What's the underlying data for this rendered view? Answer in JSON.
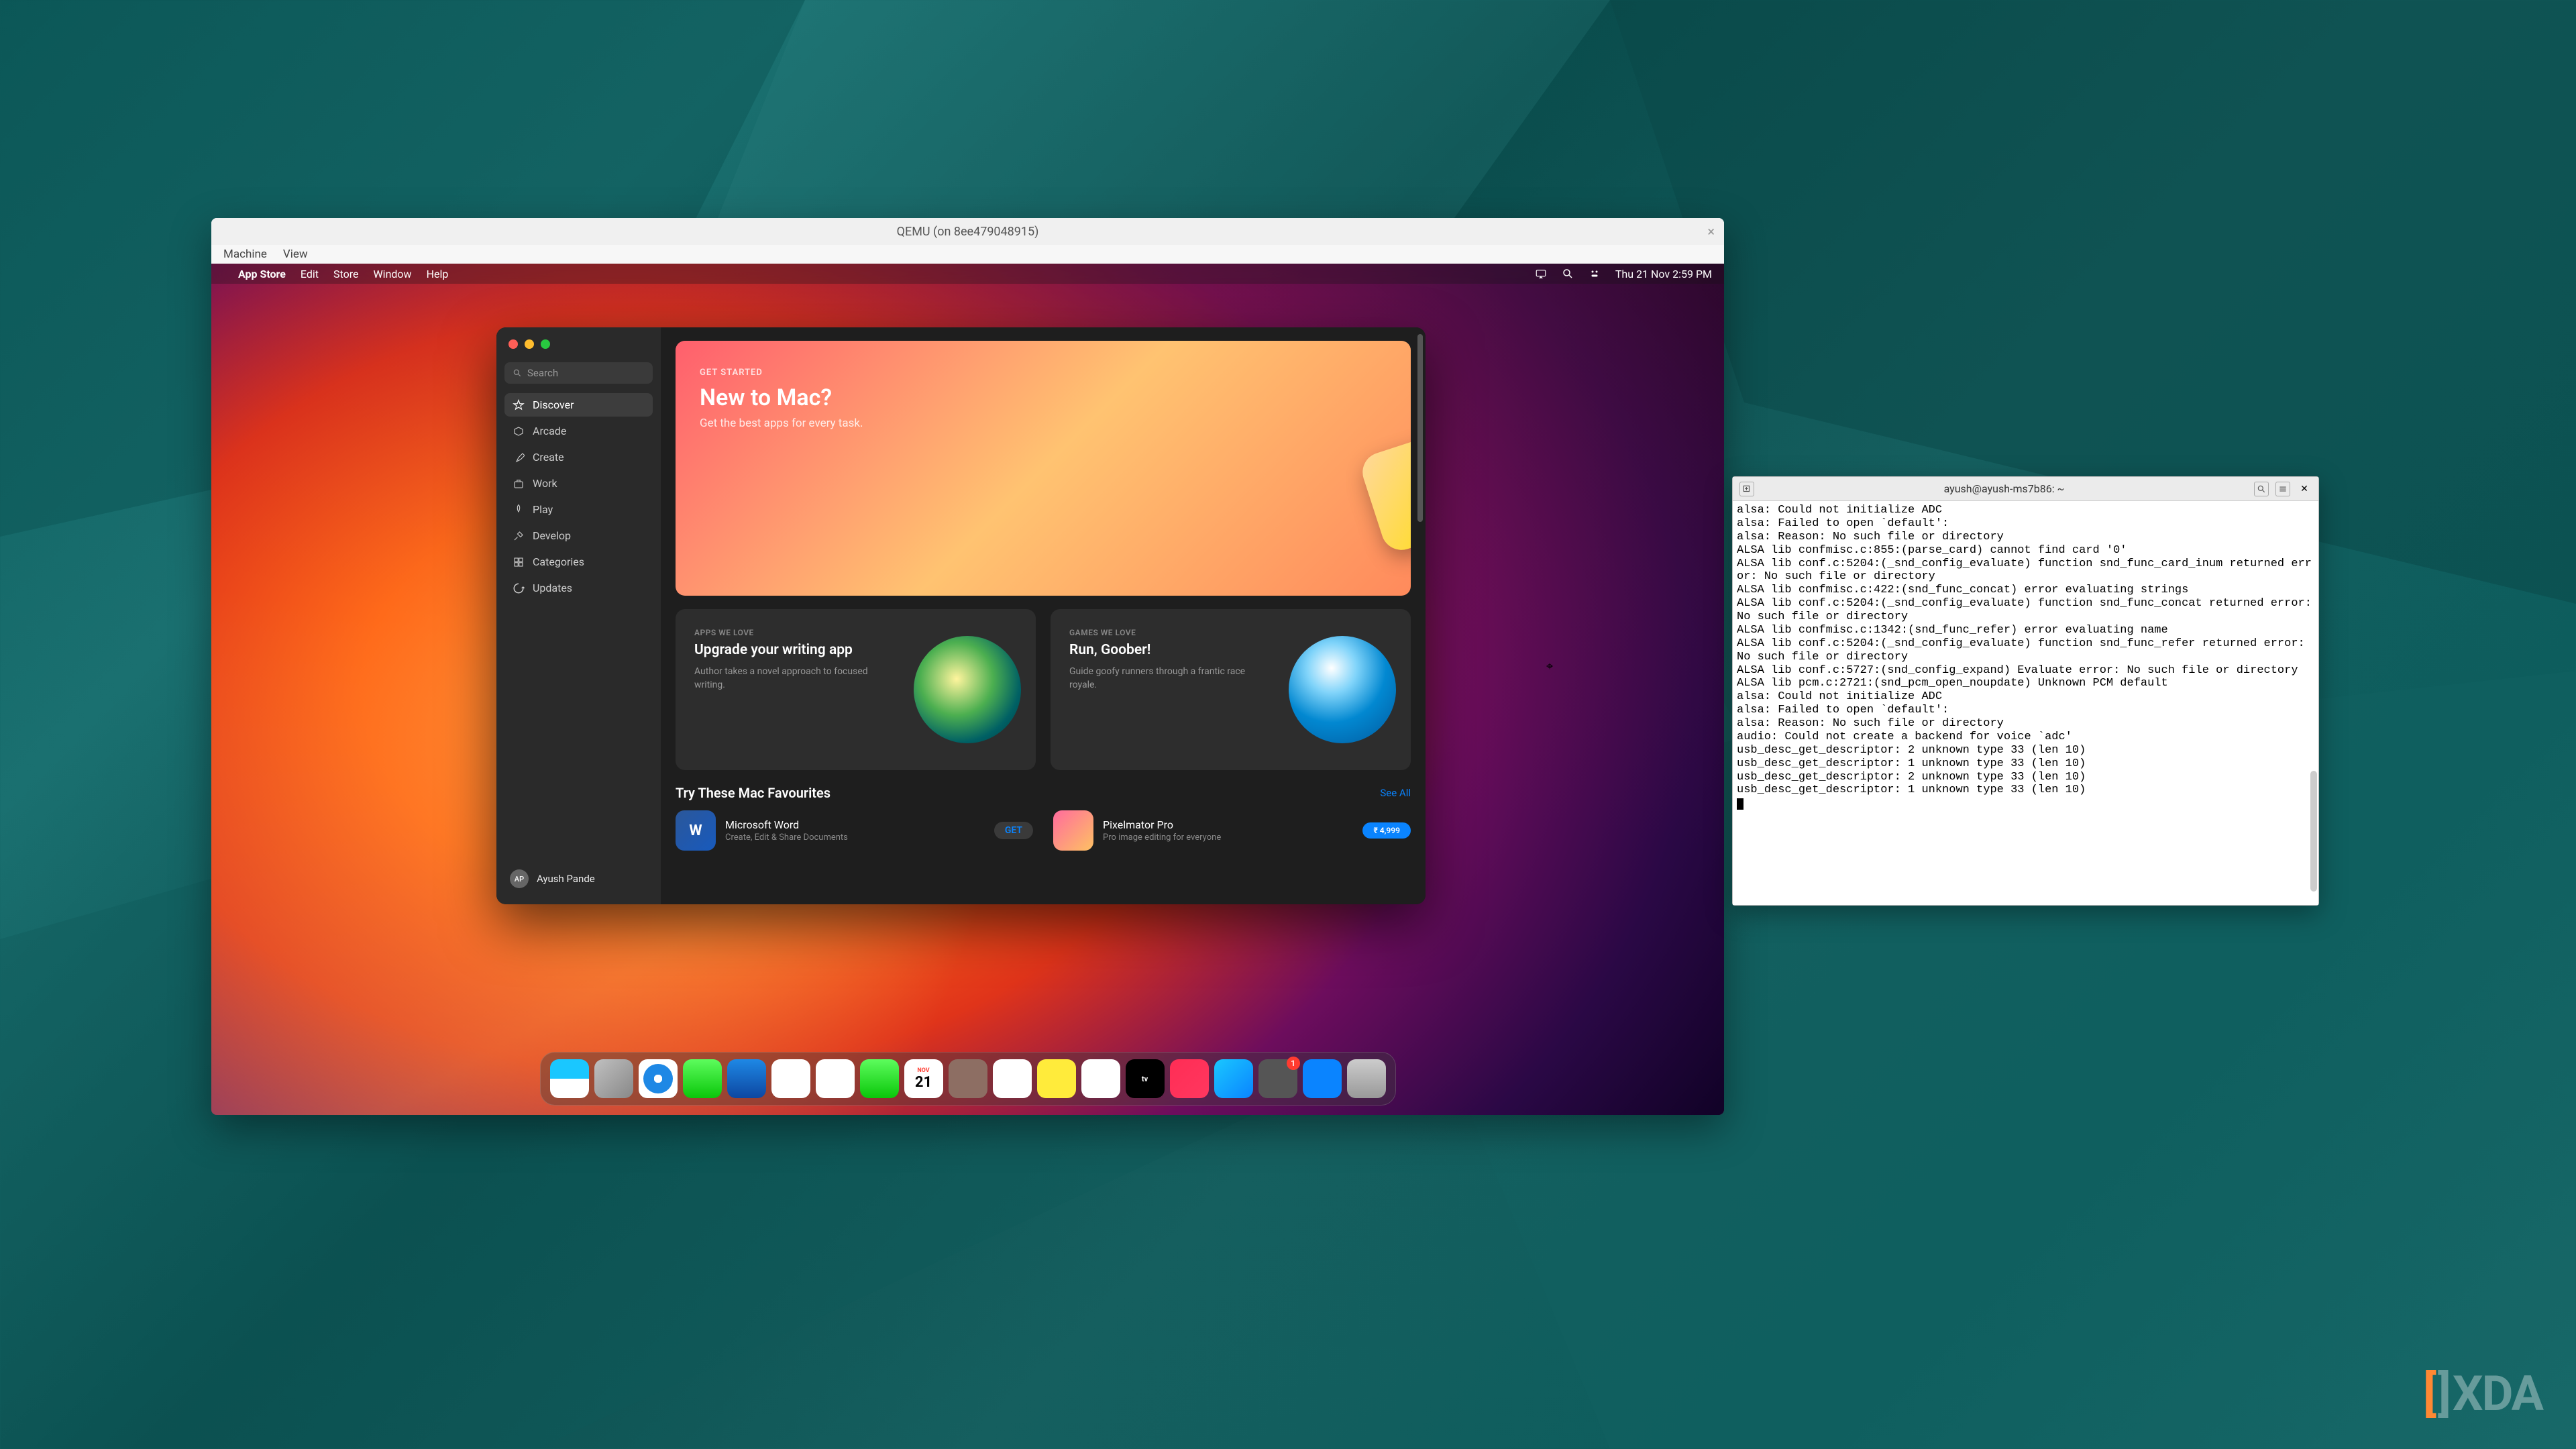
{
  "qemu": {
    "title": "QEMU (on 8ee479048915)",
    "close_glyph": "×",
    "menu": [
      "Machine",
      "View"
    ]
  },
  "mac_menubar": {
    "app": "App Store",
    "items": [
      "Edit",
      "Store",
      "Window",
      "Help"
    ],
    "datetime": "Thu 21 Nov  2:59 PM"
  },
  "appstore": {
    "search_placeholder": "Search",
    "sidebar": [
      {
        "label": "Discover",
        "active": true
      },
      {
        "label": "Arcade",
        "active": false
      },
      {
        "label": "Create",
        "active": false
      },
      {
        "label": "Work",
        "active": false
      },
      {
        "label": "Play",
        "active": false
      },
      {
        "label": "Develop",
        "active": false
      },
      {
        "label": "Categories",
        "active": false
      },
      {
        "label": "Updates",
        "active": false
      }
    ],
    "user": {
      "initials": "AP",
      "name": "Ayush Pande"
    },
    "hero": {
      "tag": "GET STARTED",
      "title": "New to Mac?",
      "sub": "Get the best apps for every task."
    },
    "love": [
      {
        "tag": "APPS WE LOVE",
        "title": "Upgrade your writing app",
        "sub": "Author takes a novel approach to focused writing."
      },
      {
        "tag": "GAMES WE LOVE",
        "title": "Run, Goober!",
        "sub": "Guide goofy runners through a frantic race royale."
      }
    ],
    "fav": {
      "heading": "Try These Mac Favourites",
      "see_all": "See All",
      "items": [
        {
          "name": "Microsoft Word",
          "desc": "Create, Edit & Share Documents",
          "btn": "GET"
        },
        {
          "name": "Pixelmator Pro",
          "desc": "Pro image editing for everyone",
          "btn": "₹ 4,999"
        }
      ]
    }
  },
  "dock": {
    "cal_month": "NOV",
    "cal_day": "21",
    "tv_label": "tv",
    "settings_badge": "1"
  },
  "terminal": {
    "title": "ayush@ayush-ms7b86: ~",
    "lines": [
      "alsa: Could not initialize ADC",
      "alsa: Failed to open `default':",
      "alsa: Reason: No such file or directory",
      "ALSA lib confmisc.c:855:(parse_card) cannot find card '0'",
      "ALSA lib conf.c:5204:(_snd_config_evaluate) function snd_func_card_inum returned error: No such file or directory",
      "ALSA lib confmisc.c:422:(snd_func_concat) error evaluating strings",
      "ALSA lib conf.c:5204:(_snd_config_evaluate) function snd_func_concat returned error: No such file or directory",
      "ALSA lib confmisc.c:1342:(snd_func_refer) error evaluating name",
      "ALSA lib conf.c:5204:(_snd_config_evaluate) function snd_func_refer returned error: No such file or directory",
      "ALSA lib conf.c:5727:(snd_config_expand) Evaluate error: No such file or directory",
      "ALSA lib pcm.c:2721:(snd_pcm_open_noupdate) Unknown PCM default",
      "alsa: Could not initialize ADC",
      "alsa: Failed to open `default':",
      "alsa: Reason: No such file or directory",
      "audio: Could not create a backend for voice `adc'",
      "usb_desc_get_descriptor: 2 unknown type 33 (len 10)",
      "usb_desc_get_descriptor: 1 unknown type 33 (len 10)",
      "usb_desc_get_descriptor: 2 unknown type 33 (len 10)",
      "usb_desc_get_descriptor: 1 unknown type 33 (len 10)"
    ]
  },
  "watermark": {
    "pre": "[",
    "mid": "]",
    "text": "XDA"
  }
}
